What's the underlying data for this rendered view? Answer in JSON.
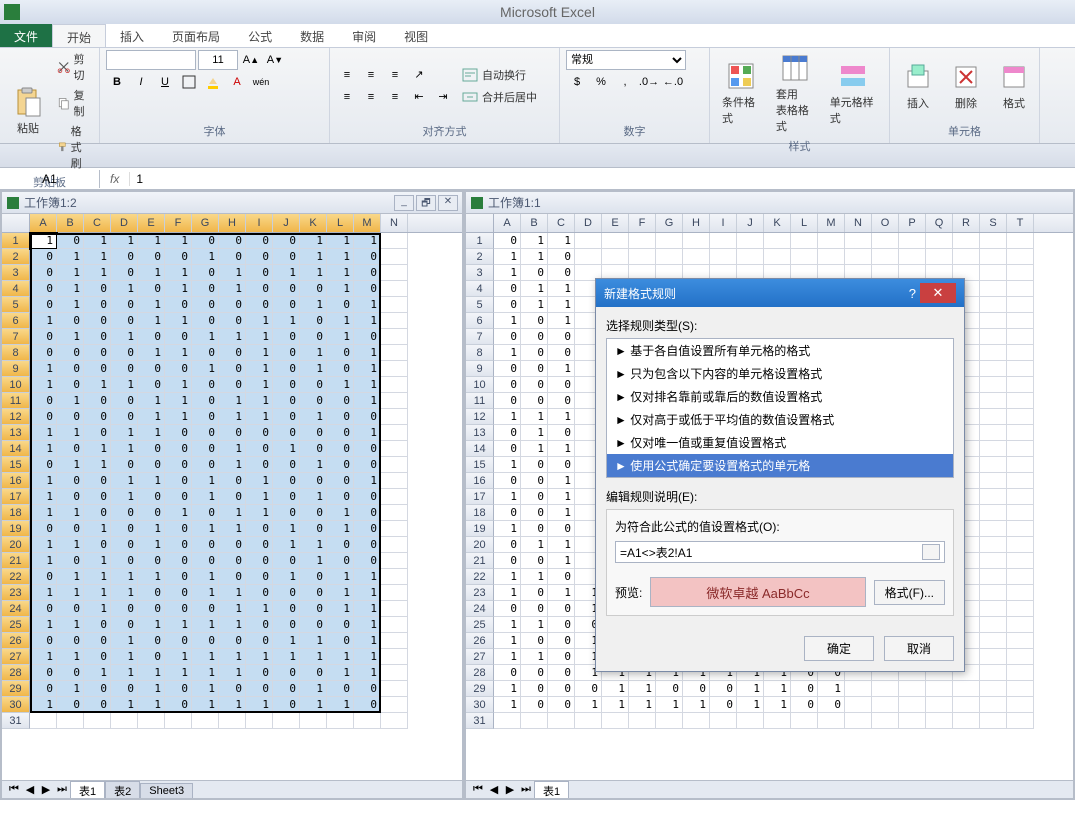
{
  "app_title": "Microsoft Excel",
  "tabs": {
    "file": "文件",
    "home": "开始",
    "insert": "插入",
    "layout": "页面布局",
    "formulas": "公式",
    "data": "数据",
    "review": "审阅",
    "view": "视图"
  },
  "ribbon": {
    "clipboard": {
      "label": "剪贴板",
      "paste": "粘贴",
      "cut": "剪切",
      "copy": "复制",
      "painter": "格式刷"
    },
    "font": {
      "label": "字体",
      "size": "11"
    },
    "align": {
      "label": "对齐方式",
      "wrap": "自动换行",
      "merge": "合并后居中"
    },
    "number": {
      "label": "数字",
      "general": "常规"
    },
    "styles": {
      "label": "样式",
      "cond": "条件格式",
      "table": "套用\n表格格式",
      "cell": "单元格样式"
    },
    "cells": {
      "label": "单元格",
      "insert": "插入",
      "delete": "删除",
      "format": "格式"
    }
  },
  "namebox": "A1",
  "formula_value": "1",
  "pane_left": {
    "title": "工作簿1:2"
  },
  "pane_right": {
    "title": "工作簿1:1"
  },
  "col_letters": [
    "A",
    "B",
    "C",
    "D",
    "E",
    "F",
    "G",
    "H",
    "I",
    "J",
    "K",
    "L",
    "M",
    "N"
  ],
  "col_letters_r": [
    "A",
    "B",
    "C",
    "D",
    "E",
    "F",
    "G",
    "H",
    "I",
    "J",
    "K",
    "L",
    "M",
    "N",
    "O",
    "P",
    "Q",
    "R",
    "S",
    "T"
  ],
  "left_data": [
    [
      1,
      0,
      1,
      1,
      1,
      1,
      0,
      0,
      0,
      0,
      1,
      1,
      1
    ],
    [
      0,
      1,
      1,
      0,
      0,
      0,
      1,
      0,
      0,
      0,
      1,
      1,
      0
    ],
    [
      0,
      1,
      1,
      0,
      1,
      1,
      0,
      1,
      0,
      1,
      1,
      1,
      0
    ],
    [
      0,
      1,
      0,
      1,
      0,
      1,
      0,
      1,
      0,
      0,
      0,
      1,
      0
    ],
    [
      0,
      1,
      0,
      0,
      1,
      0,
      0,
      0,
      0,
      0,
      1,
      0,
      1
    ],
    [
      1,
      0,
      0,
      0,
      1,
      1,
      0,
      0,
      1,
      1,
      0,
      1,
      1
    ],
    [
      0,
      1,
      0,
      1,
      0,
      0,
      1,
      1,
      1,
      0,
      0,
      1,
      0
    ],
    [
      0,
      0,
      0,
      0,
      1,
      1,
      0,
      0,
      1,
      0,
      1,
      0,
      1
    ],
    [
      1,
      0,
      0,
      0,
      0,
      0,
      1,
      0,
      1,
      0,
      1,
      0,
      1
    ],
    [
      1,
      0,
      1,
      1,
      0,
      1,
      0,
      0,
      1,
      0,
      0,
      1,
      1
    ],
    [
      0,
      1,
      0,
      0,
      1,
      1,
      0,
      1,
      1,
      0,
      0,
      0,
      1
    ],
    [
      0,
      0,
      0,
      0,
      1,
      1,
      0,
      1,
      1,
      0,
      1,
      0,
      0
    ],
    [
      1,
      1,
      0,
      1,
      1,
      0,
      0,
      0,
      0,
      0,
      0,
      0,
      1
    ],
    [
      1,
      0,
      1,
      1,
      0,
      0,
      0,
      1,
      0,
      1,
      0,
      0,
      0
    ],
    [
      0,
      1,
      1,
      0,
      0,
      0,
      0,
      1,
      0,
      0,
      1,
      0,
      0
    ],
    [
      1,
      0,
      0,
      1,
      1,
      0,
      1,
      0,
      1,
      0,
      0,
      0,
      1
    ],
    [
      1,
      0,
      0,
      1,
      0,
      0,
      1,
      0,
      1,
      0,
      1,
      0,
      0
    ],
    [
      1,
      1,
      0,
      0,
      0,
      1,
      0,
      1,
      1,
      0,
      0,
      1,
      0
    ],
    [
      0,
      0,
      1,
      0,
      1,
      0,
      1,
      1,
      0,
      1,
      0,
      1,
      0
    ],
    [
      1,
      1,
      0,
      0,
      1,
      0,
      0,
      0,
      0,
      1,
      1,
      0,
      0
    ],
    [
      1,
      0,
      1,
      0,
      0,
      0,
      0,
      0,
      0,
      0,
      1,
      0,
      0
    ],
    [
      0,
      1,
      1,
      1,
      1,
      0,
      1,
      0,
      0,
      1,
      0,
      1,
      1
    ],
    [
      1,
      1,
      1,
      1,
      0,
      0,
      1,
      1,
      0,
      0,
      0,
      1,
      1
    ],
    [
      0,
      0,
      1,
      0,
      0,
      0,
      0,
      1,
      1,
      0,
      0,
      1,
      1
    ],
    [
      1,
      1,
      0,
      0,
      1,
      1,
      1,
      1,
      0,
      0,
      0,
      0,
      1
    ],
    [
      0,
      0,
      0,
      1,
      0,
      0,
      0,
      0,
      0,
      1,
      1,
      0,
      1
    ],
    [
      1,
      1,
      0,
      1,
      0,
      1,
      1,
      1,
      1,
      1,
      1,
      1,
      1
    ],
    [
      0,
      0,
      1,
      1,
      1,
      1,
      1,
      1,
      0,
      0,
      0,
      1,
      1
    ],
    [
      0,
      1,
      0,
      0,
      1,
      0,
      1,
      0,
      0,
      0,
      1,
      0,
      0
    ],
    [
      1,
      0,
      0,
      1,
      1,
      0,
      1,
      1,
      1,
      0,
      1,
      1,
      0
    ]
  ],
  "right_data": [
    [
      0,
      1,
      1
    ],
    [
      1,
      1,
      0
    ],
    [
      1,
      0,
      0
    ],
    [
      0,
      1,
      1
    ],
    [
      0,
      1,
      1
    ],
    [
      1,
      0,
      1
    ],
    [
      0,
      0,
      0
    ],
    [
      1,
      0,
      0
    ],
    [
      0,
      0,
      1
    ],
    [
      0,
      0,
      0
    ],
    [
      0,
      0,
      0
    ],
    [
      1,
      1,
      1
    ],
    [
      0,
      1,
      0
    ],
    [
      0,
      1,
      1
    ],
    [
      1,
      0,
      0
    ],
    [
      0,
      0,
      1
    ],
    [
      1,
      0,
      1
    ],
    [
      0,
      0,
      1
    ],
    [
      1,
      0,
      0
    ],
    [
      0,
      1,
      1
    ],
    [
      0,
      0,
      1
    ],
    [
      1,
      1,
      0
    ],
    [
      1,
      0,
      1,
      1,
      0,
      0,
      1,
      1,
      0,
      0,
      1,
      1,
      1
    ],
    [
      0,
      0,
      0,
      1,
      0,
      0,
      0,
      0,
      1,
      0,
      0,
      1,
      0
    ],
    [
      1,
      1,
      0,
      0,
      1,
      1,
      0,
      1,
      1,
      0,
      0,
      1,
      1
    ],
    [
      1,
      0,
      0,
      1,
      0,
      0,
      0,
      0,
      0,
      1,
      0,
      0,
      0
    ],
    [
      1,
      1,
      0,
      1,
      0,
      1,
      1,
      0,
      1,
      1,
      0,
      1,
      1
    ],
    [
      0,
      0,
      0,
      1,
      1,
      1,
      1,
      1,
      1,
      1,
      1,
      0,
      0
    ],
    [
      1,
      0,
      0,
      0,
      1,
      1,
      0,
      0,
      0,
      1,
      1,
      0,
      1
    ],
    [
      1,
      0,
      0,
      1,
      1,
      1,
      1,
      1,
      0,
      1,
      1,
      0,
      0
    ]
  ],
  "sheets": {
    "s1": "表1",
    "s2": "表2",
    "s3": "Sheet3"
  },
  "dialog": {
    "title": "新建格式规则",
    "section1": "选择规则类型(S):",
    "rules": [
      "基于各自值设置所有单元格的格式",
      "只为包含以下内容的单元格设置格式",
      "仅对排名靠前或靠后的数值设置格式",
      "仅对高于或低于平均值的数值设置格式",
      "仅对唯一值或重复值设置格式",
      "使用公式确定要设置格式的单元格"
    ],
    "section2": "编辑规则说明(E):",
    "formula_label": "为符合此公式的值设置格式(O):",
    "formula": "=A1<>表2!A1",
    "preview_label": "预览:",
    "preview_text": "微软卓越 AaBbCc",
    "format_btn": "格式(F)...",
    "ok": "确定",
    "cancel": "取消"
  }
}
